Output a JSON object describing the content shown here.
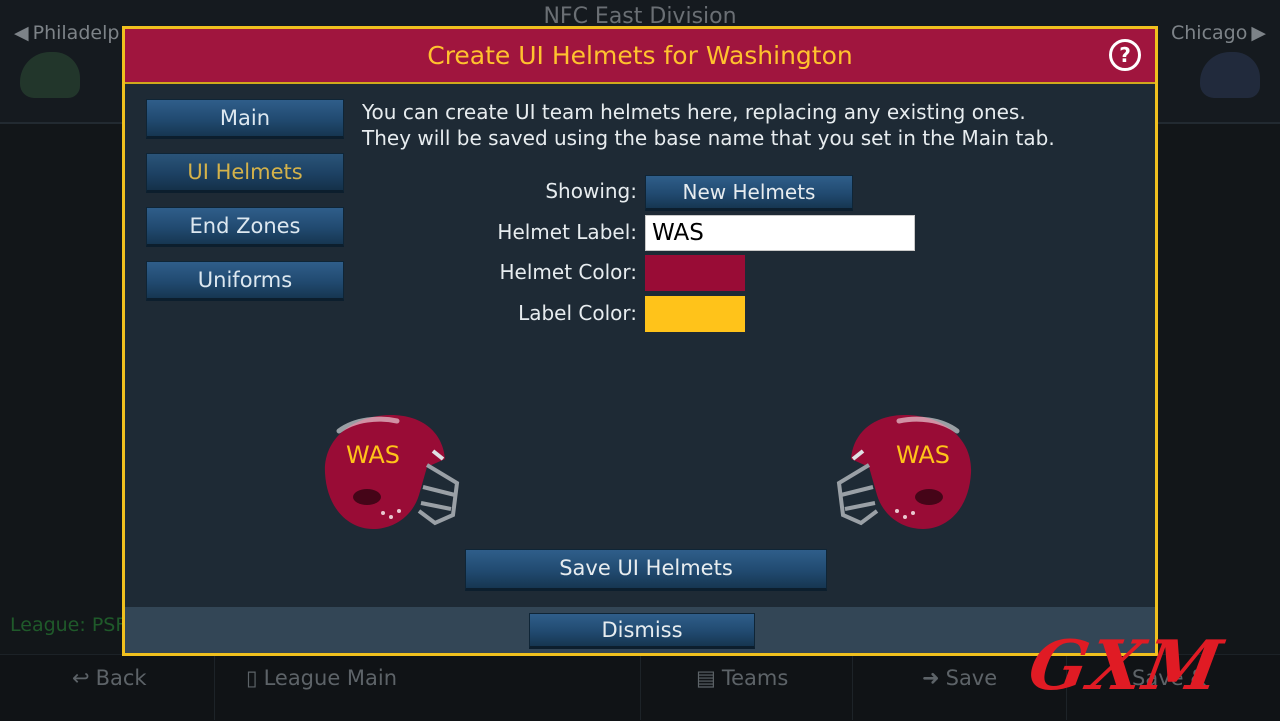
{
  "background": {
    "division_title": "NFC East Division",
    "prev_team": "Philadelp",
    "next_team": "Chicago",
    "league_text": "League: PSF",
    "bottom_bar": {
      "back": "Back",
      "league_main": "League Main",
      "teams": "Teams",
      "save": "Save",
      "save_and": "Save &"
    }
  },
  "dialog": {
    "title": "Create UI Helmets for Washington",
    "help_glyph": "?",
    "nav": {
      "main": "Main",
      "ui_helmets": "UI Helmets",
      "end_zones": "End Zones",
      "uniforms": "Uniforms",
      "active": "UI Helmets"
    },
    "intro_line1": "You can create UI team helmets here, replacing any existing ones.",
    "intro_line2": "They will be saved using the base name that you set in the Main tab.",
    "form": {
      "showing_label": "Showing:",
      "showing_value": "New Helmets",
      "helmet_label_label": "Helmet Label:",
      "helmet_label_value": "WAS",
      "helmet_color_label": "Helmet Color:",
      "helmet_color": "#990c36",
      "label_color_label": "Label Color:",
      "label_color": "#ffc31a"
    },
    "preview_label": "WAS",
    "save_button": "Save UI Helmets",
    "dismiss_button": "Dismiss"
  },
  "watermark": "GXM",
  "icons": {
    "prev": "arrow-left-icon",
    "next": "arrow-right-icon",
    "back": "back-arrow-icon",
    "league_main": "clipboard-icon",
    "teams": "bus-icon",
    "save": "arrow-right-icon",
    "help": "question-circle-icon"
  }
}
